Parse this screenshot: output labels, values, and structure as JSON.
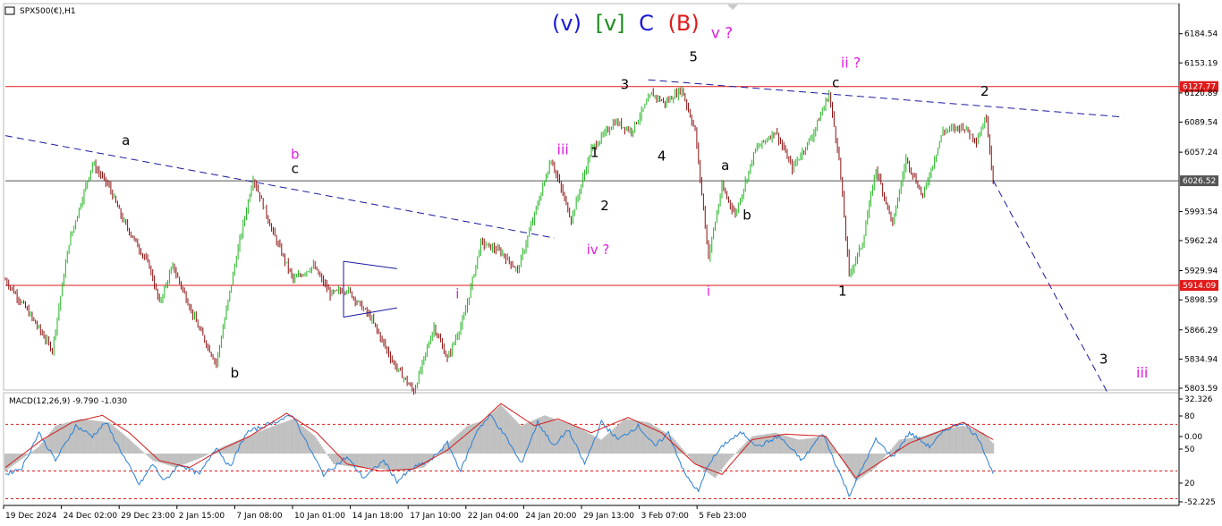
{
  "header": {
    "symbol_label": "SPX500(€),H1",
    "macd_label": "MACD(12,26,9) -9.790 -1.030"
  },
  "title_parts": [
    {
      "text": "(v)",
      "color": "#1a1ad6"
    },
    {
      "text": "[v]",
      "color": "#1e8c1e"
    },
    {
      "text": "C",
      "color": "#1a1ad6"
    },
    {
      "text": "(B)",
      "color": "#e01a1a"
    }
  ],
  "chart_data": [
    {
      "type": "line",
      "role": "price",
      "title": "SPX500(€),H1",
      "x_ticks": [
        "19 Dec 2024",
        "24 Dec 02:00",
        "29 Dec 23:00",
        "2 Jan 15:00",
        "7 Jan 08:00",
        "10 Jan 01:00",
        "14 Jan 18:00",
        "17 Jan 10:00",
        "22 Jan 04:00",
        "24 Jan 20:00",
        "29 Jan 13:00",
        "3 Feb 07:00",
        "5 Feb 23:00"
      ],
      "y_ticks": [
        "6184.54",
        "6153.19",
        "6120.89",
        "6089.54",
        "6057.24",
        "5993.54",
        "5962.24",
        "5929.94",
        "5898.59",
        "5866.29",
        "5834.94",
        "5803.59"
      ],
      "ylim": [
        5803.59,
        6215
      ],
      "price_tags": [
        {
          "value": 6127.77,
          "label": "6127.77",
          "color": "#e01a1a"
        },
        {
          "value": 6026.52,
          "label": "6026.52",
          "color": "#555555"
        },
        {
          "value": 5914.09,
          "label": "5914.09",
          "color": "#e01a1a"
        }
      ],
      "pivots": [
        {
          "bar": 0,
          "price": 5920
        },
        {
          "bar": 12,
          "price": 5890
        },
        {
          "bar": 28,
          "price": 5845
        },
        {
          "bar": 38,
          "price": 5960
        },
        {
          "bar": 52,
          "price": 6045
        },
        {
          "bar": 62,
          "price": 6020
        },
        {
          "bar": 70,
          "price": 5985
        },
        {
          "bar": 86,
          "price": 5935
        },
        {
          "bar": 92,
          "price": 5895
        },
        {
          "bar": 100,
          "price": 5935
        },
        {
          "bar": 115,
          "price": 5870
        },
        {
          "bar": 126,
          "price": 5830
        },
        {
          "bar": 138,
          "price": 5945
        },
        {
          "bar": 148,
          "price": 6030
        },
        {
          "bar": 160,
          "price": 5970
        },
        {
          "bar": 172,
          "price": 5920
        },
        {
          "bar": 184,
          "price": 5935
        },
        {
          "bar": 194,
          "price": 5905
        },
        {
          "bar": 204,
          "price": 5910
        },
        {
          "bar": 218,
          "price": 5880
        },
        {
          "bar": 232,
          "price": 5830
        },
        {
          "bar": 244,
          "price": 5800
        },
        {
          "bar": 256,
          "price": 5870
        },
        {
          "bar": 264,
          "price": 5835
        },
        {
          "bar": 274,
          "price": 5880
        },
        {
          "bar": 284,
          "price": 5960
        },
        {
          "bar": 296,
          "price": 5950
        },
        {
          "bar": 306,
          "price": 5930
        },
        {
          "bar": 316,
          "price": 5990
        },
        {
          "bar": 326,
          "price": 6050
        },
        {
          "bar": 338,
          "price": 5985
        },
        {
          "bar": 350,
          "price": 6060
        },
        {
          "bar": 364,
          "price": 6090
        },
        {
          "bar": 374,
          "price": 6080
        },
        {
          "bar": 386,
          "price": 6120
        },
        {
          "bar": 394,
          "price": 6110
        },
        {
          "bar": 404,
          "price": 6125
        },
        {
          "bar": 412,
          "price": 6080
        },
        {
          "bar": 420,
          "price": 5945
        },
        {
          "bar": 428,
          "price": 6020
        },
        {
          "bar": 436,
          "price": 5990
        },
        {
          "bar": 448,
          "price": 6060
        },
        {
          "bar": 460,
          "price": 6080
        },
        {
          "bar": 470,
          "price": 6040
        },
        {
          "bar": 482,
          "price": 6075
        },
        {
          "bar": 492,
          "price": 6120
        },
        {
          "bar": 498,
          "price": 6050
        },
        {
          "bar": 504,
          "price": 5925
        },
        {
          "bar": 512,
          "price": 5960
        },
        {
          "bar": 520,
          "price": 6040
        },
        {
          "bar": 530,
          "price": 5980
        },
        {
          "bar": 538,
          "price": 6050
        },
        {
          "bar": 548,
          "price": 6010
        },
        {
          "bar": 560,
          "price": 6080
        },
        {
          "bar": 572,
          "price": 6085
        },
        {
          "bar": 580,
          "price": 6070
        },
        {
          "bar": 586,
          "price": 6095
        },
        {
          "bar": 590,
          "price": 6027
        }
      ],
      "trendlines": [
        {
          "from": {
            "bar": 0,
            "price": 6075
          },
          "to": {
            "bar": 328,
            "price": 5965
          },
          "color": "#1a1aa0",
          "style": "dashed"
        },
        {
          "from": {
            "bar": 384,
            "price": 6135
          },
          "to": {
            "bar": 668,
            "price": 6095
          },
          "color": "#1a1aa0",
          "style": "dashed"
        },
        {
          "from": {
            "bar": 590,
            "price": 6027
          },
          "to": {
            "bar": 658,
            "price": 5800
          },
          "color": "#1a1aa0",
          "style": "dashed"
        },
        {
          "from": {
            "bar": 202,
            "price": 5940
          },
          "to": {
            "bar": 234,
            "price": 5932
          },
          "color": "#1a1aa0",
          "style": "solid"
        },
        {
          "from": {
            "bar": 202,
            "price": 5880
          },
          "to": {
            "bar": 234,
            "price": 5890
          },
          "color": "#1a1aa0",
          "style": "solid"
        },
        {
          "from": {
            "bar": 202,
            "price": 5880
          },
          "to": {
            "bar": 202,
            "price": 5940
          },
          "color": "#1a1aa0",
          "style": "solid"
        }
      ],
      "wave_labels": [
        {
          "text": "a",
          "color": "#000000",
          "bar": 72,
          "price": 6065,
          "size": 15
        },
        {
          "text": "b",
          "color": "#e020e0",
          "bar": 173,
          "price": 6050,
          "size": 15
        },
        {
          "text": "c",
          "color": "#000000",
          "bar": 173,
          "price": 6035,
          "size": 15
        },
        {
          "text": "b",
          "color": "#000000",
          "bar": 137,
          "price": 5815,
          "size": 15
        },
        {
          "text": "i",
          "color": "#e020e0",
          "bar": 270,
          "price": 5900,
          "size": 15
        },
        {
          "text": "iii",
          "color": "#e020e0",
          "bar": 333,
          "price": 6055,
          "size": 16
        },
        {
          "text": "1",
          "color": "#000000",
          "bar": 352,
          "price": 6052,
          "size": 15
        },
        {
          "text": "2",
          "color": "#000000",
          "bar": 358,
          "price": 5995,
          "size": 15
        },
        {
          "text": "iv ?",
          "color": "#e020e0",
          "bar": 354,
          "price": 5948,
          "size": 15
        },
        {
          "text": "3",
          "color": "#000000",
          "bar": 370,
          "price": 6125,
          "size": 15
        },
        {
          "text": "4",
          "color": "#000000",
          "bar": 392,
          "price": 6048,
          "size": 15
        },
        {
          "text": "5",
          "color": "#000000",
          "bar": 411,
          "price": 6155,
          "size": 15
        },
        {
          "text": "v ?",
          "color": "#e020e0",
          "bar": 428,
          "price": 6180,
          "size": 17
        },
        {
          "text": "a",
          "color": "#000000",
          "bar": 430,
          "price": 6038,
          "size": 15
        },
        {
          "text": "b",
          "color": "#000000",
          "bar": 443,
          "price": 5985,
          "size": 15
        },
        {
          "text": "i",
          "color": "#e020e0",
          "bar": 420,
          "price": 5903,
          "size": 15
        },
        {
          "text": "ii ?",
          "color": "#e020e0",
          "bar": 505,
          "price": 6148,
          "size": 16
        },
        {
          "text": "c",
          "color": "#000000",
          "bar": 496,
          "price": 6127,
          "size": 15
        },
        {
          "text": "1",
          "color": "#000000",
          "bar": 500,
          "price": 5903,
          "size": 15
        },
        {
          "text": "2",
          "color": "#000000",
          "bar": 585,
          "price": 6118,
          "size": 15
        },
        {
          "text": "3",
          "color": "#000000",
          "bar": 656,
          "price": 5830,
          "size": 15
        },
        {
          "text": "iii",
          "color": "#e020e0",
          "bar": 679,
          "price": 5815,
          "size": 16
        }
      ]
    },
    {
      "type": "area",
      "role": "indicator",
      "title": "MACD(12,26,9) -9.790 -1.030",
      "y_ticks": [
        "32.326",
        "80",
        "0.00",
        "50",
        "20",
        "-52.225"
      ],
      "histogram_pivots": [
        {
          "bar": 0,
          "value": -25
        },
        {
          "bar": 20,
          "value": 10
        },
        {
          "bar": 30,
          "value": 40
        },
        {
          "bar": 45,
          "value": 50
        },
        {
          "bar": 62,
          "value": 45
        },
        {
          "bar": 72,
          "value": 25
        },
        {
          "bar": 88,
          "value": -10
        },
        {
          "bar": 102,
          "value": -20
        },
        {
          "bar": 118,
          "value": -5
        },
        {
          "bar": 130,
          "value": 10
        },
        {
          "bar": 140,
          "value": 20
        },
        {
          "bar": 155,
          "value": 35
        },
        {
          "bar": 172,
          "value": 50
        },
        {
          "bar": 185,
          "value": 25
        },
        {
          "bar": 196,
          "value": -15
        },
        {
          "bar": 210,
          "value": -20
        },
        {
          "bar": 224,
          "value": -22
        },
        {
          "bar": 238,
          "value": -25
        },
        {
          "bar": 250,
          "value": -20
        },
        {
          "bar": 262,
          "value": 10
        },
        {
          "bar": 276,
          "value": 40
        },
        {
          "bar": 286,
          "value": 48
        },
        {
          "bar": 296,
          "value": 70
        },
        {
          "bar": 308,
          "value": 40
        },
        {
          "bar": 322,
          "value": 55
        },
        {
          "bar": 340,
          "value": 40
        },
        {
          "bar": 356,
          "value": 20
        },
        {
          "bar": 370,
          "value": 50
        },
        {
          "bar": 384,
          "value": 45
        },
        {
          "bar": 398,
          "value": 25
        },
        {
          "bar": 412,
          "value": -15
        },
        {
          "bar": 424,
          "value": -35
        },
        {
          "bar": 432,
          "value": -10
        },
        {
          "bar": 446,
          "value": 25
        },
        {
          "bar": 460,
          "value": 30
        },
        {
          "bar": 474,
          "value": 20
        },
        {
          "bar": 490,
          "value": 25
        },
        {
          "bar": 500,
          "value": -10
        },
        {
          "bar": 508,
          "value": -40
        },
        {
          "bar": 520,
          "value": -20
        },
        {
          "bar": 534,
          "value": 20
        },
        {
          "bar": 548,
          "value": 25
        },
        {
          "bar": 560,
          "value": 35
        },
        {
          "bar": 572,
          "value": 40
        },
        {
          "bar": 584,
          "value": 30
        },
        {
          "bar": 590,
          "value": 15
        }
      ],
      "macd_pivots": [
        {
          "bar": 0,
          "value": -30
        },
        {
          "bar": 10,
          "value": -20
        },
        {
          "bar": 20,
          "value": 30
        },
        {
          "bar": 30,
          "value": -10
        },
        {
          "bar": 42,
          "value": 40
        },
        {
          "bar": 52,
          "value": 25
        },
        {
          "bar": 60,
          "value": 45
        },
        {
          "bar": 72,
          "value": -10
        },
        {
          "bar": 80,
          "value": -45
        },
        {
          "bar": 88,
          "value": -15
        },
        {
          "bar": 95,
          "value": -40
        },
        {
          "bar": 104,
          "value": -15
        },
        {
          "bar": 116,
          "value": -30
        },
        {
          "bar": 126,
          "value": 10
        },
        {
          "bar": 134,
          "value": -20
        },
        {
          "bar": 144,
          "value": 30
        },
        {
          "bar": 160,
          "value": 45
        },
        {
          "bar": 172,
          "value": 55
        },
        {
          "bar": 180,
          "value": 15
        },
        {
          "bar": 190,
          "value": -30
        },
        {
          "bar": 204,
          "value": -5
        },
        {
          "bar": 214,
          "value": -35
        },
        {
          "bar": 226,
          "value": -10
        },
        {
          "bar": 234,
          "value": -40
        },
        {
          "bar": 244,
          "value": -20
        },
        {
          "bar": 254,
          "value": -10
        },
        {
          "bar": 264,
          "value": 15
        },
        {
          "bar": 272,
          "value": -25
        },
        {
          "bar": 282,
          "value": 35
        },
        {
          "bar": 290,
          "value": 55
        },
        {
          "bar": 300,
          "value": 20
        },
        {
          "bar": 308,
          "value": -15
        },
        {
          "bar": 318,
          "value": 45
        },
        {
          "bar": 328,
          "value": 10
        },
        {
          "bar": 336,
          "value": 35
        },
        {
          "bar": 346,
          "value": -15
        },
        {
          "bar": 356,
          "value": 45
        },
        {
          "bar": 366,
          "value": 20
        },
        {
          "bar": 378,
          "value": 40
        },
        {
          "bar": 388,
          "value": 10
        },
        {
          "bar": 396,
          "value": 30
        },
        {
          "bar": 406,
          "value": -30
        },
        {
          "bar": 414,
          "value": -55
        },
        {
          "bar": 420,
          "value": -15
        },
        {
          "bar": 430,
          "value": 15
        },
        {
          "bar": 440,
          "value": 30
        },
        {
          "bar": 450,
          "value": 10
        },
        {
          "bar": 462,
          "value": 25
        },
        {
          "bar": 476,
          "value": -10
        },
        {
          "bar": 488,
          "value": 30
        },
        {
          "bar": 496,
          "value": -15
        },
        {
          "bar": 504,
          "value": -60
        },
        {
          "bar": 512,
          "value": -20
        },
        {
          "bar": 520,
          "value": 20
        },
        {
          "bar": 530,
          "value": -5
        },
        {
          "bar": 540,
          "value": 30
        },
        {
          "bar": 552,
          "value": 10
        },
        {
          "bar": 562,
          "value": 35
        },
        {
          "bar": 572,
          "value": 45
        },
        {
          "bar": 582,
          "value": 20
        },
        {
          "bar": 590,
          "value": -30
        }
      ],
      "signal_pivots": [
        {
          "bar": 0,
          "value": -20
        },
        {
          "bar": 22,
          "value": 20
        },
        {
          "bar": 40,
          "value": 45
        },
        {
          "bar": 58,
          "value": 55
        },
        {
          "bar": 74,
          "value": 30
        },
        {
          "bar": 92,
          "value": -10
        },
        {
          "bar": 110,
          "value": -20
        },
        {
          "bar": 128,
          "value": 5
        },
        {
          "bar": 146,
          "value": 25
        },
        {
          "bar": 168,
          "value": 58
        },
        {
          "bar": 186,
          "value": 30
        },
        {
          "bar": 204,
          "value": -15
        },
        {
          "bar": 224,
          "value": -25
        },
        {
          "bar": 244,
          "value": -22
        },
        {
          "bar": 264,
          "value": 5
        },
        {
          "bar": 284,
          "value": 45
        },
        {
          "bar": 296,
          "value": 72
        },
        {
          "bar": 316,
          "value": 40
        },
        {
          "bar": 330,
          "value": 50
        },
        {
          "bar": 350,
          "value": 30
        },
        {
          "bar": 372,
          "value": 52
        },
        {
          "bar": 392,
          "value": 30
        },
        {
          "bar": 412,
          "value": -15
        },
        {
          "bar": 428,
          "value": -30
        },
        {
          "bar": 446,
          "value": 20
        },
        {
          "bar": 466,
          "value": 28
        },
        {
          "bar": 490,
          "value": 25
        },
        {
          "bar": 508,
          "value": -35
        },
        {
          "bar": 524,
          "value": -10
        },
        {
          "bar": 540,
          "value": 15
        },
        {
          "bar": 556,
          "value": 30
        },
        {
          "bar": 572,
          "value": 45
        },
        {
          "bar": 590,
          "value": 20
        }
      ],
      "levels": [
        42,
        -25,
        -65
      ],
      "ylim": [
        -72,
        85
      ]
    }
  ]
}
